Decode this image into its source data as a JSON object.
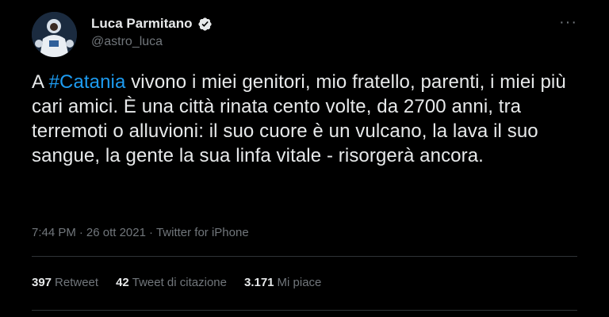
{
  "tweet": {
    "author": {
      "display_name": "Luca Parmitano",
      "handle": "@astro_luca",
      "verified": true
    },
    "more_icon": "more-horizontal-icon",
    "text_prefix": "A ",
    "hashtag": "#Catania",
    "text_body": " vivono i miei genitori, mio fratello, parenti, i miei più cari amici. È una città rinata cento volte, da 2700 anni, tra terremoti o alluvioni: il suo cuore è un vulcano, la lava il suo sangue, la gente la sua linfa vitale - risorgerà ancora.",
    "time": "7:44 PM",
    "date": "26 ott 2021",
    "source": "Twitter for iPhone",
    "separator": "·",
    "stats": [
      {
        "num": "397",
        "label": "Retweet"
      },
      {
        "num": "42",
        "label": "Tweet di citazione"
      },
      {
        "num": "3.171",
        "label": "Mi piace"
      }
    ]
  },
  "colors": {
    "background": "#000000",
    "text": "#e7e9ea",
    "secondary": "#71767b",
    "link": "#1d9bf0",
    "divider": "#2f3336"
  }
}
